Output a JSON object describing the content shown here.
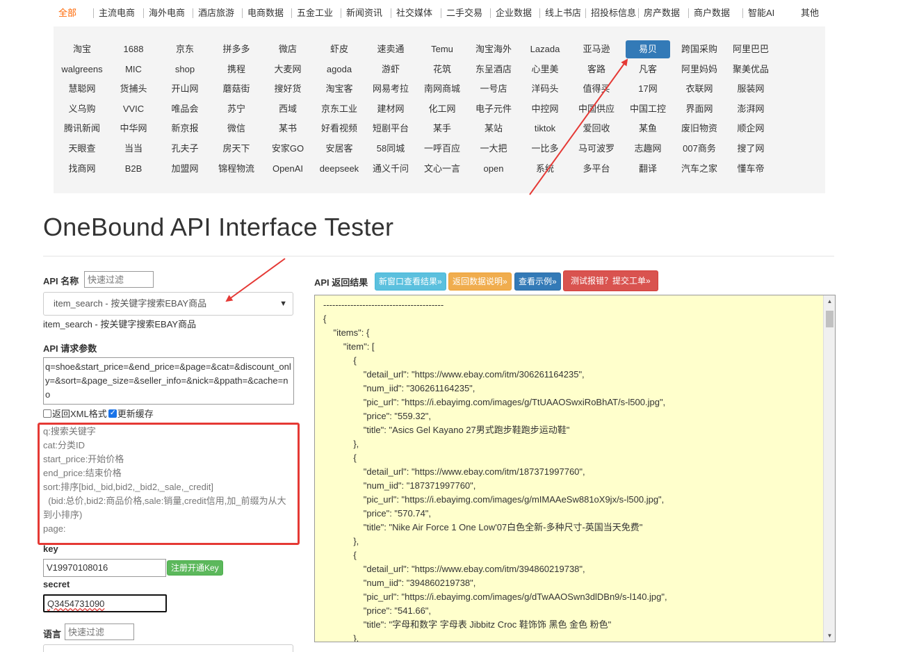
{
  "top_categories": [
    "全部",
    "主流电商",
    "海外电商",
    "酒店旅游",
    "电商数据",
    "五金工业",
    "新闻资讯",
    "社交媒体",
    "二手交易",
    "企业数据",
    "线上书店",
    "招投标信息",
    "房产数据",
    "商户数据",
    "智能AI",
    "其他"
  ],
  "active_category": "全部",
  "site_grid": [
    [
      "淘宝",
      "1688",
      "京东",
      "拼多多",
      "微店",
      "虾皮",
      "速卖通",
      "Temu",
      "淘宝海外",
      "Lazada",
      "亚马逊",
      "易贝",
      "跨国采购",
      "阿里巴巴"
    ],
    [
      "walgreens",
      "MIC",
      "shop",
      "携程",
      "大麦网",
      "agoda",
      "游虾",
      "花筑",
      "东呈酒店",
      "心里美",
      "客路",
      "凡客",
      "阿里妈妈",
      "聚美优品"
    ],
    [
      "慧聪网",
      "货捕头",
      "开山网",
      "蘑菇街",
      "搜好货",
      "淘宝客",
      "网易考拉",
      "南网商城",
      "一号店",
      "洋码头",
      "值得买",
      "17网",
      "衣联网",
      "服装网"
    ],
    [
      "义乌购",
      "VVIC",
      "唯品会",
      "苏宁",
      "西域",
      "京东工业",
      "建材网",
      "化工网",
      "电子元件",
      "中控网",
      "中国供应",
      "中国工控",
      "界面网",
      "澎湃网"
    ],
    [
      "腾讯新闻",
      "中华网",
      "新京报",
      "微信",
      "某书",
      "好看视频",
      "短剧平台",
      "某手",
      "某站",
      "tiktok",
      "爱回收",
      "某鱼",
      "废旧物资",
      "顺企网"
    ],
    [
      "天眼查",
      "当当",
      "孔夫子",
      "房天下",
      "安家GO",
      "安居客",
      "58同城",
      "一呼百应",
      "一大把",
      "一比多",
      "马可波罗",
      "志趣网",
      "007商务",
      "搜了网"
    ],
    [
      "找商网",
      "B2B",
      "加盟网",
      "锦程物流",
      "OpenAI",
      "deepseek",
      "通义千问",
      "文心一言",
      "open",
      "系统",
      "多平台",
      "翻译",
      "汽车之家",
      "懂车帝"
    ]
  ],
  "active_site": "易贝",
  "page_title": "OneBound API Interface Tester",
  "api_name": {
    "label": "API 名称",
    "filter_placeholder": "快速过滤"
  },
  "method": {
    "selected": "item_search - 按关键字搜索EBAY商品",
    "description": "item_search - 按关键字搜索EBAY商品"
  },
  "params": {
    "label": "API 请求参数",
    "value": "q=shoe&start_price=&end_price=&page=&cat=&discount_only=&sort=&page_size=&seller_info=&nick=&ppath=&cache=no"
  },
  "options": {
    "xml_label": "返回XML格式",
    "xml_checked": false,
    "cache_label": "更新缓存",
    "cache_checked": true
  },
  "param_help": [
    "q:搜索关键字",
    "cat:分类ID",
    "start_price:开始价格",
    "end_price:结束价格",
    "sort:排序[bid,_bid,bid2,_bid2,_sale,_credit]",
    "  (bid:总价,bid2:商品价格,sale:销量,credit信用,加_前缀为从大到小排序)",
    "page:"
  ],
  "key": {
    "label": "key",
    "value": "V19970108016",
    "register_button": "注册开通Key"
  },
  "secret": {
    "label": "secret",
    "value": "Q3454731090"
  },
  "language": {
    "label": "语言",
    "filter_placeholder": "快速过滤"
  },
  "result": {
    "label": "API 返回结果",
    "buttons": {
      "new_window": "新窗口查看结果»",
      "docs": "返回数据说明»",
      "example": "查看示例»",
      "report": "测试报错？提交工单»"
    },
    "json_text": "----------------------------------------\n{\n\t\"items\": {\n\t\t\"item\": [\n\t\t\t{\n\t\t\t\t\"detail_url\": \"https://www.ebay.com/itm/306261164235\",\n\t\t\t\t\"num_iid\": \"306261164235\",\n\t\t\t\t\"pic_url\": \"https://i.ebayimg.com/images/g/TtUAAOSwxiRoBhAT/s-l500.jpg\",\n\t\t\t\t\"price\": \"559.32\",\n\t\t\t\t\"title\": \"Asics Gel Kayano 27男式跑步鞋跑步运动鞋\"\n\t\t\t},\n\t\t\t{\n\t\t\t\t\"detail_url\": \"https://www.ebay.com/itm/187371997760\",\n\t\t\t\t\"num_iid\": \"187371997760\",\n\t\t\t\t\"pic_url\": \"https://i.ebayimg.com/images/g/mIMAAeSw881oX9jx/s-l500.jpg\",\n\t\t\t\t\"price\": \"570.74\",\n\t\t\t\t\"title\": \"Nike Air Force 1 One Low'07白色全新-多种尺寸-英国当天免费\"\n\t\t\t},\n\t\t\t{\n\t\t\t\t\"detail_url\": \"https://www.ebay.com/itm/394860219738\",\n\t\t\t\t\"num_iid\": \"394860219738\",\n\t\t\t\t\"pic_url\": \"https://i.ebayimg.com/images/g/dTwAAOSwn3dlDBn9/s-l140.jpg\",\n\t\t\t\t\"price\": \"541.66\",\n\t\t\t\t\"title\": \"字母和数字 字母表 Jibbitz Croc 鞋饰饰 黑色 金色 粉色\"\n\t\t\t},"
  },
  "colors": {
    "accent_orange": "#ff6600",
    "active_blue": "#337ab7",
    "result_bg": "#ffffcc",
    "annotation_red": "#e53935"
  }
}
